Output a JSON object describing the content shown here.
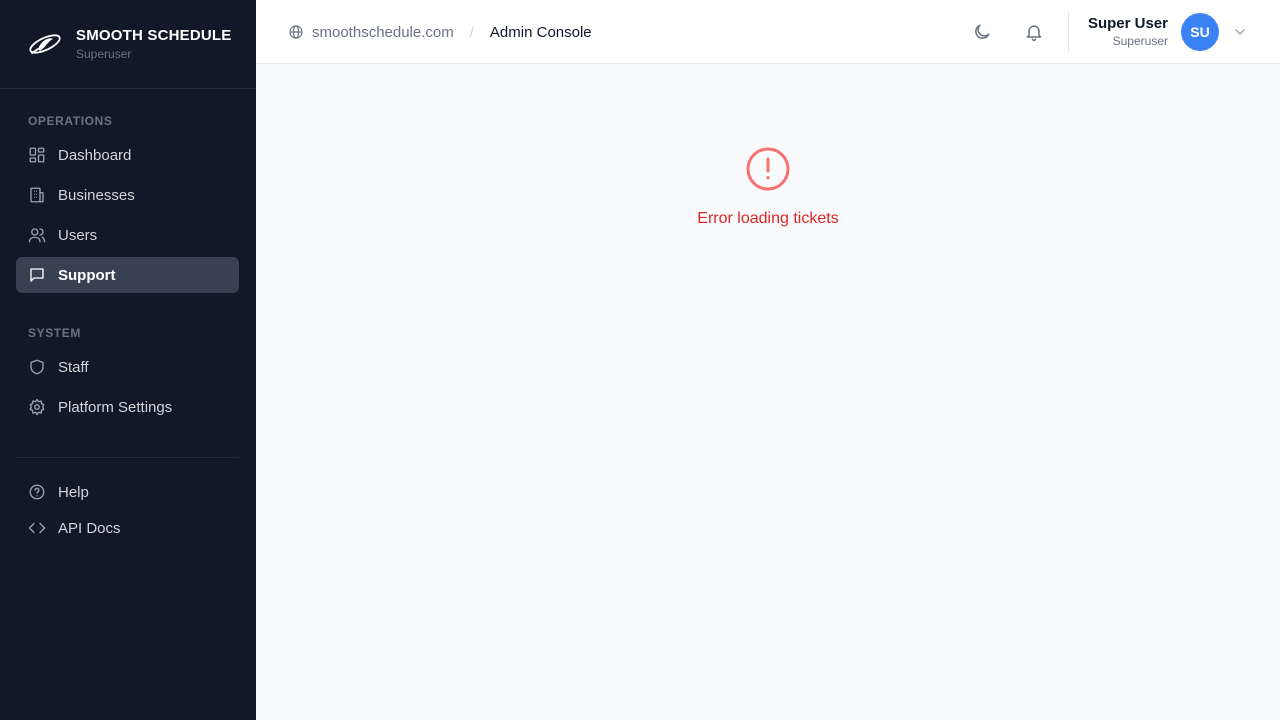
{
  "brand": {
    "title": "SMOOTH SCHEDULE",
    "subtitle": "Superuser"
  },
  "sidebar": {
    "sections": [
      {
        "label": "OPERATIONS"
      },
      {
        "label": "SYSTEM"
      }
    ],
    "items": [
      {
        "label": "Dashboard",
        "icon": "dashboard-icon"
      },
      {
        "label": "Businesses",
        "icon": "building-icon"
      },
      {
        "label": "Users",
        "icon": "users-icon"
      },
      {
        "label": "Support",
        "icon": "message-icon",
        "active": true
      },
      {
        "label": "Staff",
        "icon": "shield-icon"
      },
      {
        "label": "Platform Settings",
        "icon": "gear-icon"
      },
      {
        "label": "Help",
        "icon": "help-circle-icon"
      },
      {
        "label": "API Docs",
        "icon": "code-icon"
      }
    ]
  },
  "header": {
    "breadcrumb": {
      "domain": "smoothschedule.com",
      "separator": "/",
      "current": "Admin Console"
    },
    "user": {
      "name": "Super User",
      "role": "Superuser",
      "initials": "SU"
    }
  },
  "main": {
    "error_message": "Error loading tickets"
  },
  "colors": {
    "sidebar_bg": "#111827",
    "active_item_bg": "#374151",
    "avatar_bg": "#3b82f6",
    "error": "#dc2626",
    "error_icon": "#f87171"
  }
}
